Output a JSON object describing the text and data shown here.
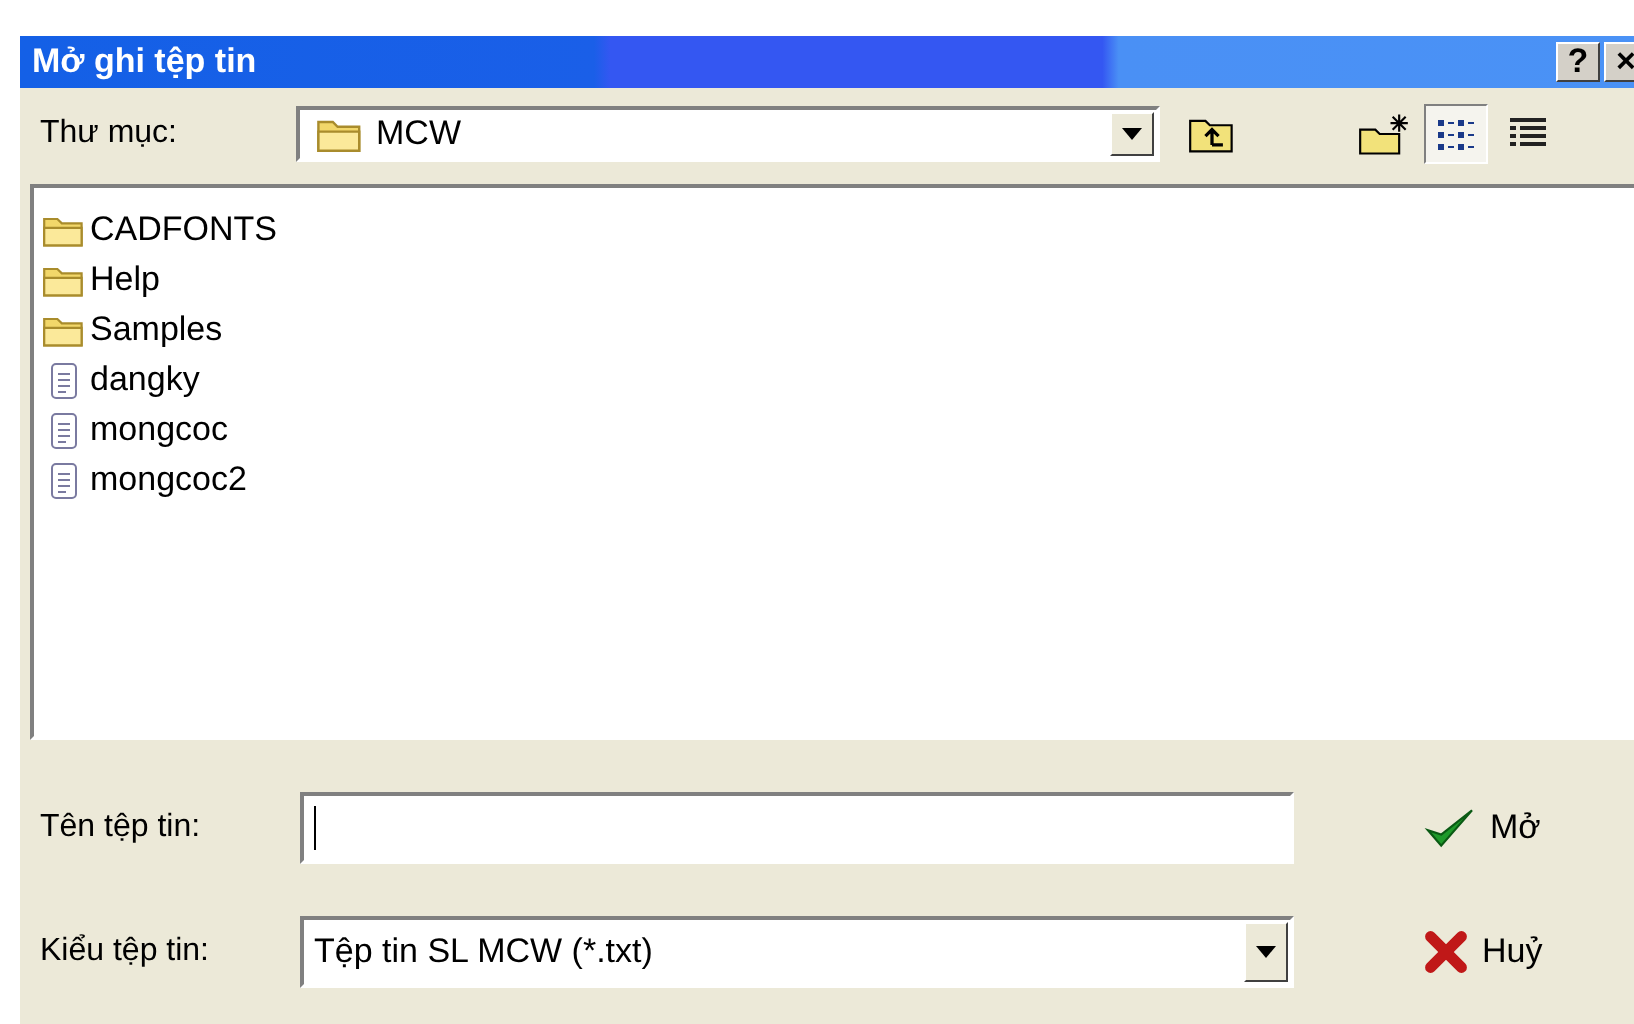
{
  "window": {
    "title": "Mở ghi tệp tin",
    "help_button": "?",
    "close_button": "×"
  },
  "folder_bar": {
    "label": "Thư mục:",
    "value": "MCW"
  },
  "toolbar": [
    {
      "kind": "up",
      "selected": false
    },
    {
      "kind": "new-folder",
      "selected": false
    },
    {
      "kind": "list",
      "selected": true
    },
    {
      "kind": "details",
      "selected": false
    }
  ],
  "files": [
    {
      "name": "CADFONTS",
      "kind": "folder"
    },
    {
      "name": "Help",
      "kind": "folder"
    },
    {
      "name": "Samples",
      "kind": "folder"
    },
    {
      "name": "dangky",
      "kind": "file"
    },
    {
      "name": "mongcoc",
      "kind": "file"
    },
    {
      "name": "mongcoc2",
      "kind": "file"
    }
  ],
  "filename": {
    "label": "Tên tệp tin:"
  },
  "filetype": {
    "label": "Kiểu tệp tin:",
    "value": "Tệp tin SL MCW (*.txt)"
  },
  "buttons": [
    {
      "label": "Mở",
      "kind": "open"
    },
    {
      "label": "Huỷ",
      "kind": "cancel"
    }
  ]
}
